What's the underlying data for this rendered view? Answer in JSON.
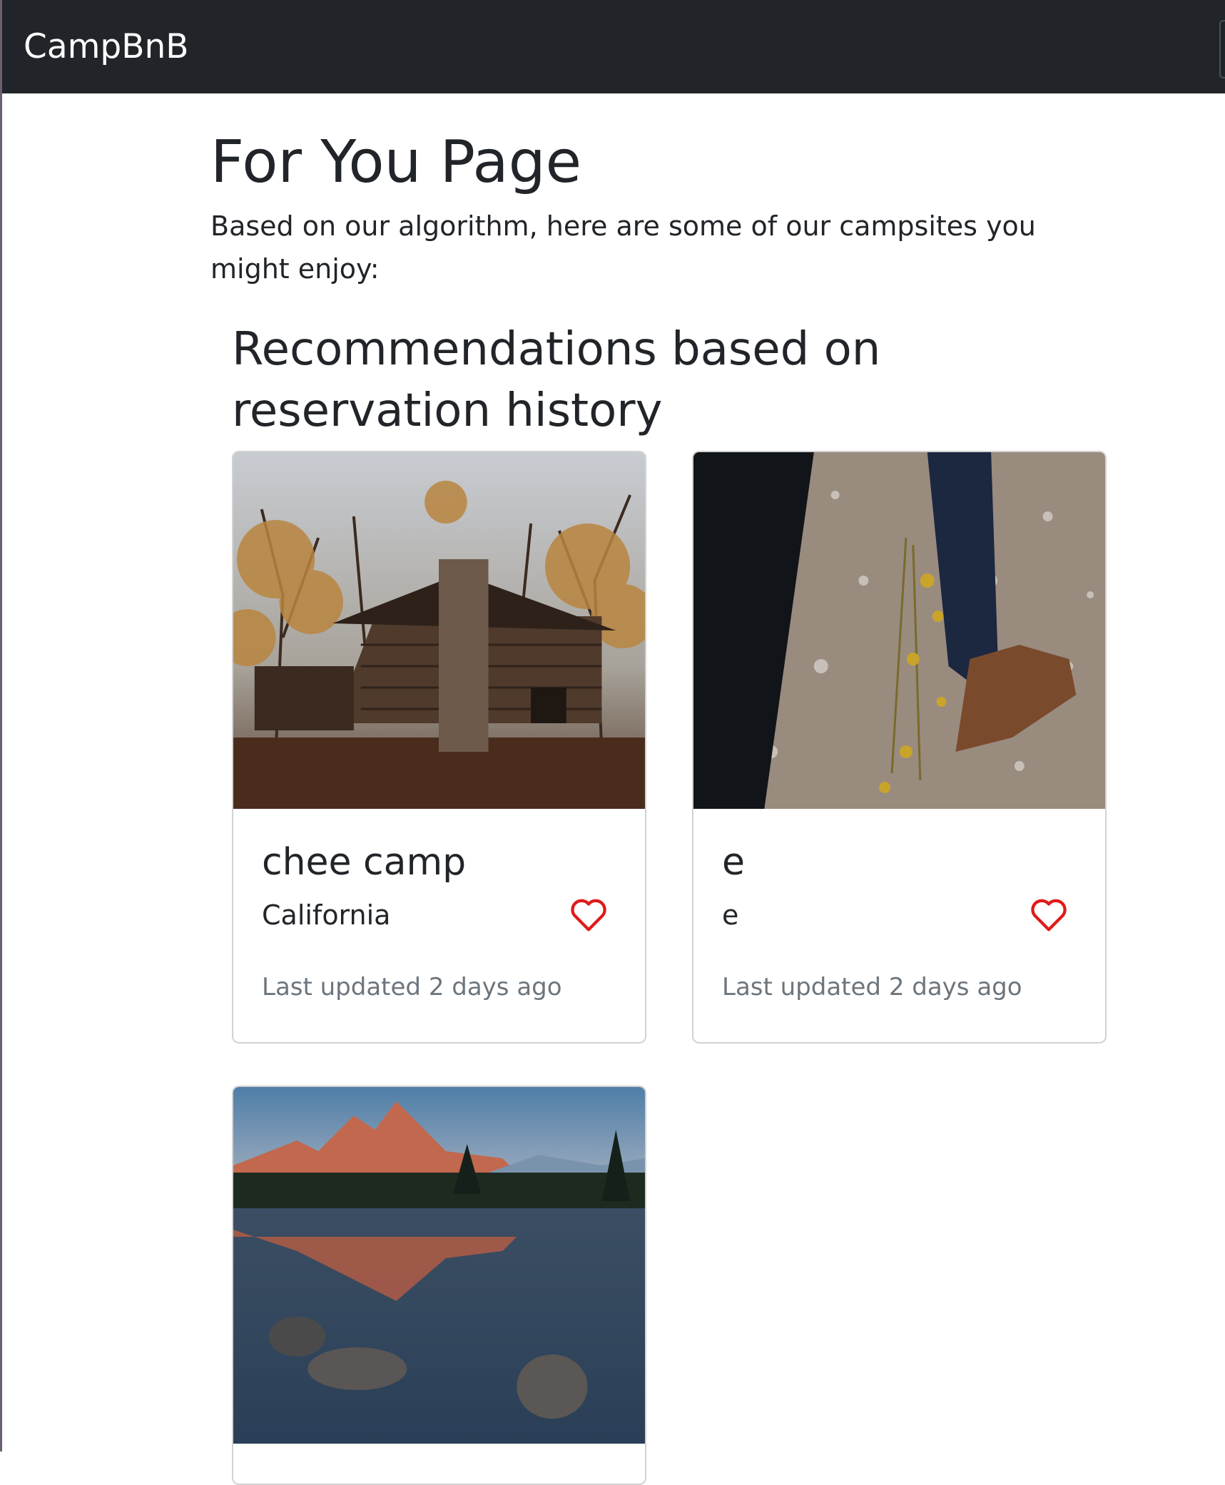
{
  "navbar": {
    "brand": "CampBnB"
  },
  "page": {
    "title": "For You Page",
    "intro": "Based on our algorithm, here are some of our campsites you might enjoy:"
  },
  "section": {
    "title": "Recommendations based on reservation history"
  },
  "cards": [
    {
      "title": "chee camp",
      "location": "California",
      "updated": "Last updated 2 days ago",
      "image": "log-cabin-autumn-forest"
    },
    {
      "title": "e",
      "location": "e",
      "updated": "Last updated 2 days ago",
      "image": "hiker-boots-wildflowers"
    },
    {
      "image": "mountain-lake-reflection"
    }
  ],
  "colors": {
    "navbar_bg": "#212529",
    "heart": "#e01a1a",
    "muted_text": "#6c757d"
  },
  "icons": {
    "favorite": "heart-outline-icon"
  }
}
